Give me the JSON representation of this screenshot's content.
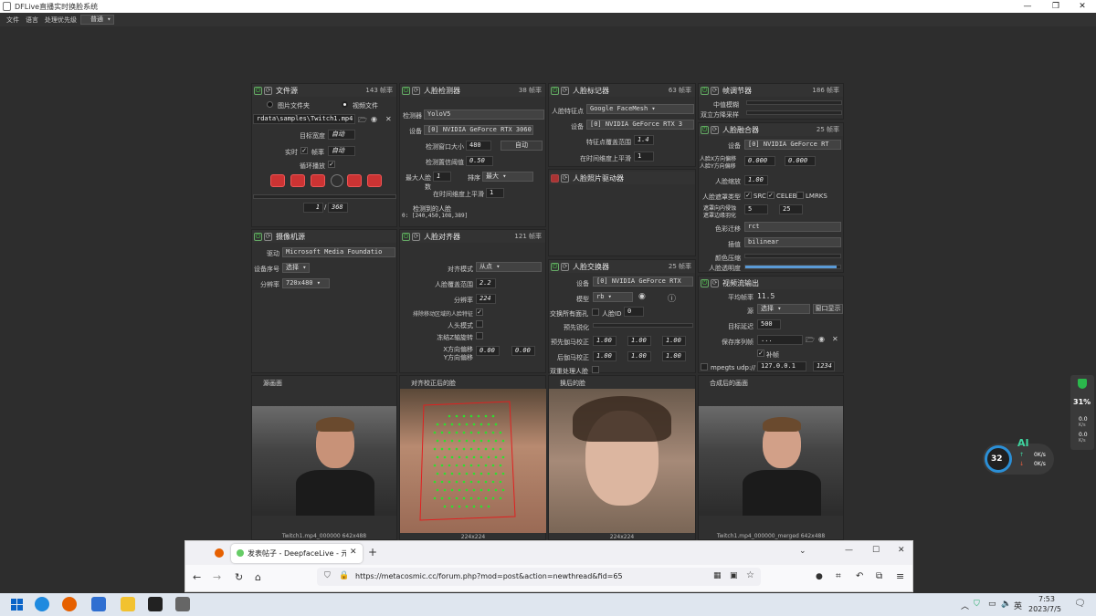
{
  "window": {
    "title": "DFLive直播实时换脸系统"
  },
  "menu": {
    "file": "文件",
    "language": "语言",
    "priority": "处理优先级",
    "priority_value": "普通"
  },
  "file_source": {
    "title": "文件源",
    "fps": "143 帧率",
    "opt_images": "图片文件夹",
    "opt_video": "视频文件",
    "path": "rdata\\samples\\Twitch1.mp4",
    "target_width_label": "目标宽度",
    "target_width": "自动",
    "realtime_label": "实时",
    "fps_label": "帧率",
    "fps_value": "自动",
    "loop_label": "循环播放",
    "frame": "1",
    "total_frames": "368"
  },
  "camera": {
    "title": "摄像机源",
    "driver_label": "驱动",
    "driver": "Microsoft Media Foundatio",
    "device_label": "设备序号",
    "device": "选择",
    "res_label": "分辨率",
    "resolution": "720x480"
  },
  "face_detector": {
    "title": "人脸检测器",
    "fps": "38 帧率",
    "detector_label": "检测器",
    "detector": "YoloV5",
    "device_label": "设备",
    "device": "[0] NVIDIA GeForce RTX 3060",
    "window_label": "检测窗口大小",
    "window": "480",
    "auto_btn": "自动",
    "threshold_label": "检测置信阈值",
    "threshold": "0.50",
    "max_faces_label": "最大人脸数",
    "max_faces": "1",
    "sort_label": "排序",
    "sort": "最大",
    "smooth_label": "在时间维度上平滑",
    "smooth": "1",
    "detected_label": "检测到的人脸",
    "detected_value": "0: [240,450,108,389]"
  },
  "face_aligner": {
    "title": "人脸对齐器",
    "fps": "121 帧率",
    "mode_label": "对齐模式",
    "mode": "从点",
    "coverage_label": "人脸覆盖范围",
    "coverage": "2.2",
    "res_label": "分辨率",
    "resolution": "224",
    "exclude_label": "排除移动区域的人脸特征",
    "head_label": "人头模式",
    "freeze_label": "冻结Z轴旋转",
    "xoff_label": "X方向偏移",
    "yoff_label": "Y方向偏移",
    "xoff": "0.00",
    "yoff": "0.00"
  },
  "face_marker": {
    "title": "人脸标记器",
    "fps": "63 帧率",
    "type_label": "人脸特征点",
    "type": "Google FaceMesh",
    "device_label": "设备",
    "device": "[0] NVIDIA GeForce RTX 3",
    "range_label": "特征点覆盖范围",
    "range": "1.4",
    "smooth_label": "在时间维度上平滑",
    "smooth": "1"
  },
  "face_animator": {
    "title": "人脸照片驱动器"
  },
  "face_swapper": {
    "title": "人脸交换器",
    "fps": "25 帧率",
    "device_label": "设备",
    "device": "[0] NVIDIA GeForce RTX",
    "model_label": "模型",
    "model": "rb",
    "swap_all_label": "交换所有面孔",
    "face_id_label": "人脸ID",
    "face_id": "0",
    "pre_sharpen_label": "预先锐化",
    "pre_gamma_label": "预先伽马校正",
    "gamma": "1.00",
    "post_gamma_label": "后伽马校正",
    "two_pass_label": "双重处理人脸"
  },
  "frame_adjuster": {
    "title": "帧调节器",
    "fps": "186 帧率",
    "median_label": "中值模糊",
    "degrade_label": "双立方降采样"
  },
  "face_merger": {
    "title": "人脸融合器",
    "fps": "25 帧率",
    "device_label": "设备",
    "device": "[0] NVIDIA GeForce RT",
    "xoff_label": "人脸X方向偏移",
    "yoff_label": "人脸Y方向偏移",
    "xoff": "0.000",
    "yoff": "0.000",
    "scale_label": "人脸缩放",
    "scale": "1.00",
    "mask_label": "人脸遮罩类型",
    "mask_src": "SRC",
    "mask_celeb": "CELEB",
    "mask_lmrks": "LMRKS",
    "erode_label": "遮罩向内侵蚀",
    "blur_label": "遮罩边缘羽化",
    "erode": "5",
    "blur": "25",
    "color_label": "色彩迁移",
    "color": "rct",
    "interp_label": "插值",
    "interp": "bilinear",
    "compress_label": "颜色压缩",
    "opacity_label": "人脸透明度"
  },
  "stream_output": {
    "title": "视频流输出",
    "avg_fps_label": "平均帧率",
    "avg_fps": "11.5",
    "source_label": "源",
    "source": "选择",
    "window_btn": "窗口显示",
    "delay_label": "目标延迟",
    "delay": "500",
    "save_label": "保存序列帧",
    "save_path": "...",
    "fill_label": "补帧",
    "mpegts_label": "mpegts udp://",
    "ip": "127.0.0.1",
    "port": "1234"
  },
  "views": {
    "source": "源画面",
    "aligned": "对齐校正后的脸",
    "swapped": "换后的脸",
    "merged": "合成后的画面",
    "source_caption": "Twitch1.mp4_000000 642x488",
    "aligned_caption": "224x224",
    "swapped_caption": "224x224",
    "merged_caption": "Twitch1.mp4_000000_merged 642x488"
  },
  "browser": {
    "tab": "发表帖子 - DeepfaceLive - 元",
    "url": "https://metacosmic.cc/forum.php?mod=post&action=newthread&fid=65"
  },
  "taskbar": {
    "time": "7:53",
    "date": "2023/7/5",
    "ime": "英"
  },
  "widget": {
    "cpu": "31%",
    "gpu": "32",
    "ai": "AI",
    "up": "0K/s",
    "down": "0K/s",
    "n1": "0.0",
    "n2": "0.0",
    "unit": "K/s"
  }
}
